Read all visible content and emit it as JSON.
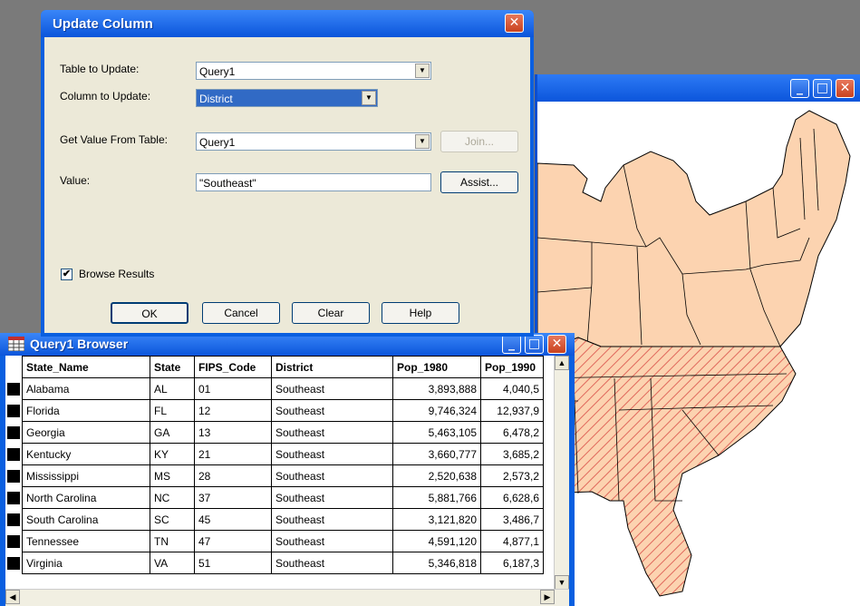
{
  "dialog": {
    "title": "Update Column",
    "table_label": "Table to Update:",
    "table_value": "Query1",
    "column_label": "Column to Update:",
    "column_value": "District",
    "source_label": "Get Value From Table:",
    "source_value": "Query1",
    "join_label": "Join...",
    "value_label": "Value:",
    "value_value": "\"Southeast\"",
    "assist_label": "Assist...",
    "browse_label": "Browse Results",
    "browse_checked": true,
    "ok_label": "OK",
    "cancel_label": "Cancel",
    "clear_label": "Clear",
    "help_label": "Help"
  },
  "browser": {
    "title": "Query1 Browser",
    "columns": [
      "State_Name",
      "State",
      "FIPS_Code",
      "District",
      "Pop_1980",
      "Pop_1990"
    ],
    "rows": [
      [
        "Alabama",
        "AL",
        "01",
        "Southeast",
        "3,893,888",
        "4,040,5"
      ],
      [
        "Florida",
        "FL",
        "12",
        "Southeast",
        "9,746,324",
        "12,937,9"
      ],
      [
        "Georgia",
        "GA",
        "13",
        "Southeast",
        "5,463,105",
        "6,478,2"
      ],
      [
        "Kentucky",
        "KY",
        "21",
        "Southeast",
        "3,660,777",
        "3,685,2"
      ],
      [
        "Mississippi",
        "MS",
        "28",
        "Southeast",
        "2,520,638",
        "2,573,2"
      ],
      [
        "North Carolina",
        "NC",
        "37",
        "Southeast",
        "5,881,766",
        "6,628,6"
      ],
      [
        "South Carolina",
        "SC",
        "45",
        "Southeast",
        "3,121,820",
        "3,486,7"
      ],
      [
        "Tennessee",
        "TN",
        "47",
        "Southeast",
        "4,591,120",
        "4,877,1"
      ],
      [
        "Virginia",
        "VA",
        "51",
        "Southeast",
        "5,346,818",
        "6,187,3"
      ]
    ]
  },
  "colors": {
    "titlebar": "#0b55db",
    "map_fill": "#fcd3b0",
    "map_hatch": "#e0685c",
    "dialog_face": "#ece9d8"
  }
}
